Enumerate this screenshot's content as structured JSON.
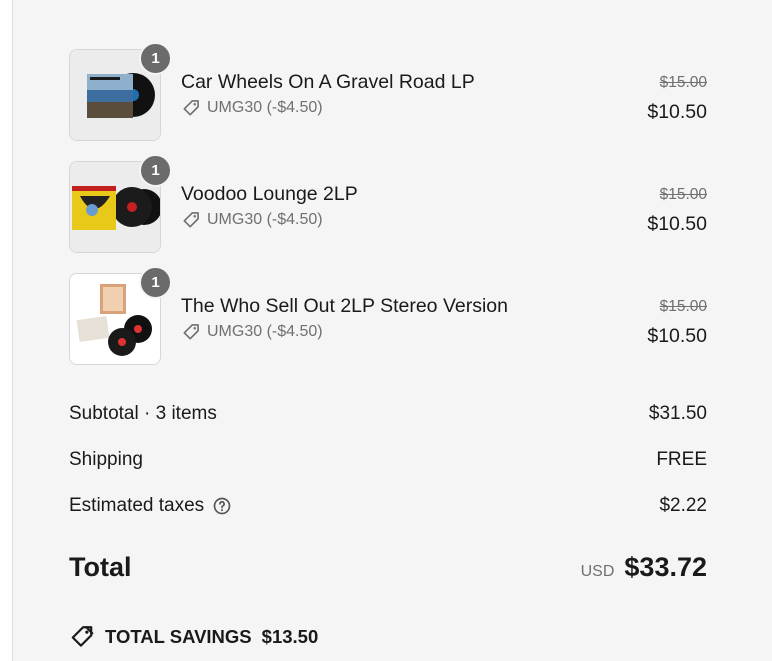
{
  "items": [
    {
      "title": "Car Wheels On A Gravel Road LP",
      "quantity": "1",
      "discount": "UMG30 (-$4.50)",
      "original_price": "$15.00",
      "price": "$10.50",
      "icon": "vinyl-record-thumbnail"
    },
    {
      "title": "Voodoo Lounge 2LP",
      "quantity": "1",
      "discount": "UMG30 (-$4.50)",
      "original_price": "$15.00",
      "price": "$10.50",
      "icon": "vinyl-record-thumbnail"
    },
    {
      "title": "The Who Sell Out 2LP Stereo Version",
      "quantity": "1",
      "discount": "UMG30 (-$4.50)",
      "original_price": "$15.00",
      "price": "$10.50",
      "icon": "vinyl-record-thumbnail"
    }
  ],
  "summary": {
    "subtotal_label": "Subtotal · 3 items",
    "subtotal_value": "$31.50",
    "shipping_label": "Shipping",
    "shipping_value": "FREE",
    "taxes_label": "Estimated taxes",
    "taxes_value": "$2.22",
    "total_label": "Total",
    "currency": "USD",
    "total_value": "$33.72"
  },
  "savings": {
    "label": "TOTAL SAVINGS",
    "value": "$13.50"
  },
  "colors": {
    "panel_bg": "#f5f5f5",
    "badge_bg": "#6b6b6b",
    "muted_text": "#707070"
  }
}
